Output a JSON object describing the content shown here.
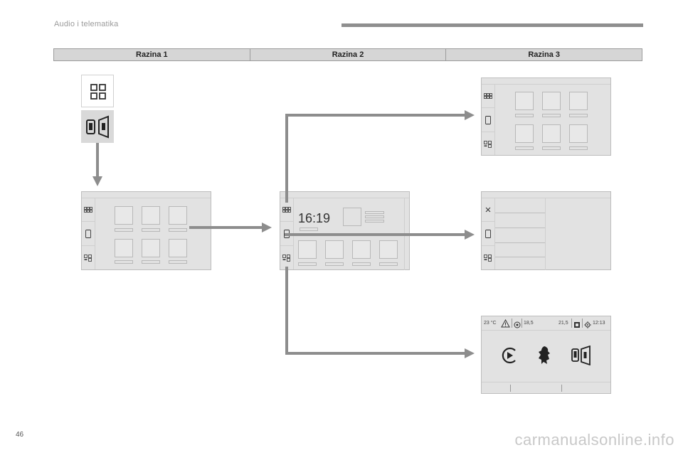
{
  "header": {
    "title": "Audio i telematika"
  },
  "levels": [
    "Razina 1",
    "Razina 2",
    "Razina 3"
  ],
  "clock_screen": {
    "time": "16:19"
  },
  "status_bar": {
    "temperature": "23 °C",
    "value_left": "18,5",
    "value_right": "21,5",
    "time": "12:13"
  },
  "page": {
    "number": "46"
  },
  "watermark": "carmanualsonline.info",
  "colors": {
    "screen_bg": "#e2e2e2",
    "arrow": "#8d8d8d",
    "level_bar": "#d6d6d6"
  }
}
